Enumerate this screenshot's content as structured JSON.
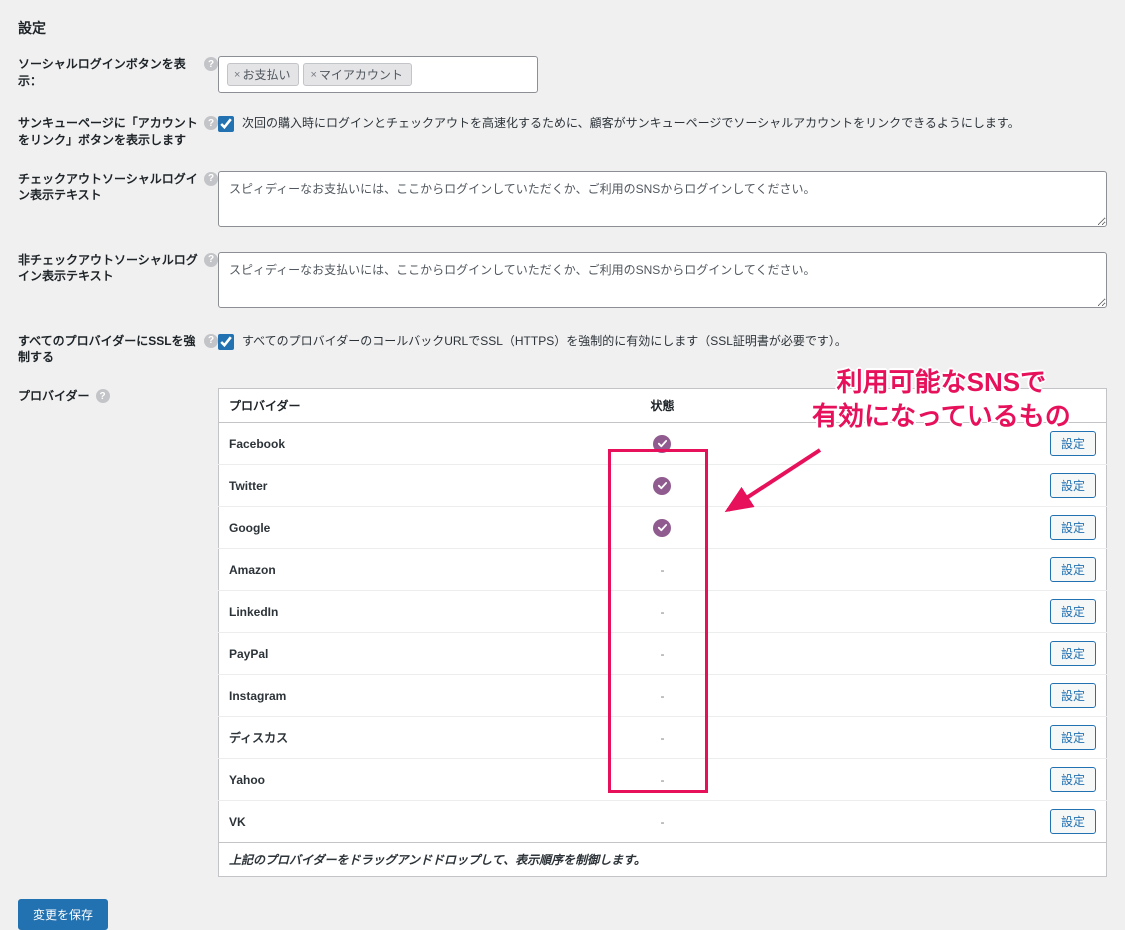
{
  "page_title": "設定",
  "rows": {
    "social_login_buttons": {
      "label": "ソーシャルログインボタンを表示：",
      "tags": [
        "お支払い",
        "マイアカウント"
      ]
    },
    "thank_you_link": {
      "label": "サンキューページに「アカウントをリンク」ボタンを表示します",
      "checkbox_text": "次回の購入時にログインとチェックアウトを高速化するために、顧客がサンキューページでソーシャルアカウントをリンクできるようにします。"
    },
    "checkout_text": {
      "label": "チェックアウトソーシャルログイン表示テキスト",
      "value": "スピィディーなお支払いには、ここからログインしていただくか、ご利用のSNSからログインしてください。"
    },
    "non_checkout_text": {
      "label": "非チェックアウトソーシャルログイン表示テキスト",
      "value": "スピィディーなお支払いには、ここからログインしていただくか、ご利用のSNSからログインしてください。"
    },
    "force_ssl": {
      "label": "すべてのプロバイダーにSSLを強制する",
      "checkbox_text": "すべてのプロバイダーのコールバックURLでSSL（HTTPS）を強制的に有効にします（SSL証明書が必要です）。"
    },
    "providers": {
      "label": "プロバイダー",
      "th_provider": "プロバイダー",
      "th_status": "状態",
      "config_btn": "設定",
      "footer_note": "上記のプロバイダーをドラッグアンドドロップして、表示順序を制御します。",
      "list": [
        {
          "name": "Facebook",
          "enabled": true
        },
        {
          "name": "Twitter",
          "enabled": true
        },
        {
          "name": "Google",
          "enabled": true
        },
        {
          "name": "Amazon",
          "enabled": false
        },
        {
          "name": "LinkedIn",
          "enabled": false
        },
        {
          "name": "PayPal",
          "enabled": false
        },
        {
          "name": "Instagram",
          "enabled": false
        },
        {
          "name": "ディスカス",
          "enabled": false
        },
        {
          "name": "Yahoo",
          "enabled": false
        },
        {
          "name": "VK",
          "enabled": false
        }
      ]
    }
  },
  "save_button": "変更を保存",
  "annotation": {
    "line1": "利用可能なSNSで",
    "line2": "有効になっているもの"
  }
}
